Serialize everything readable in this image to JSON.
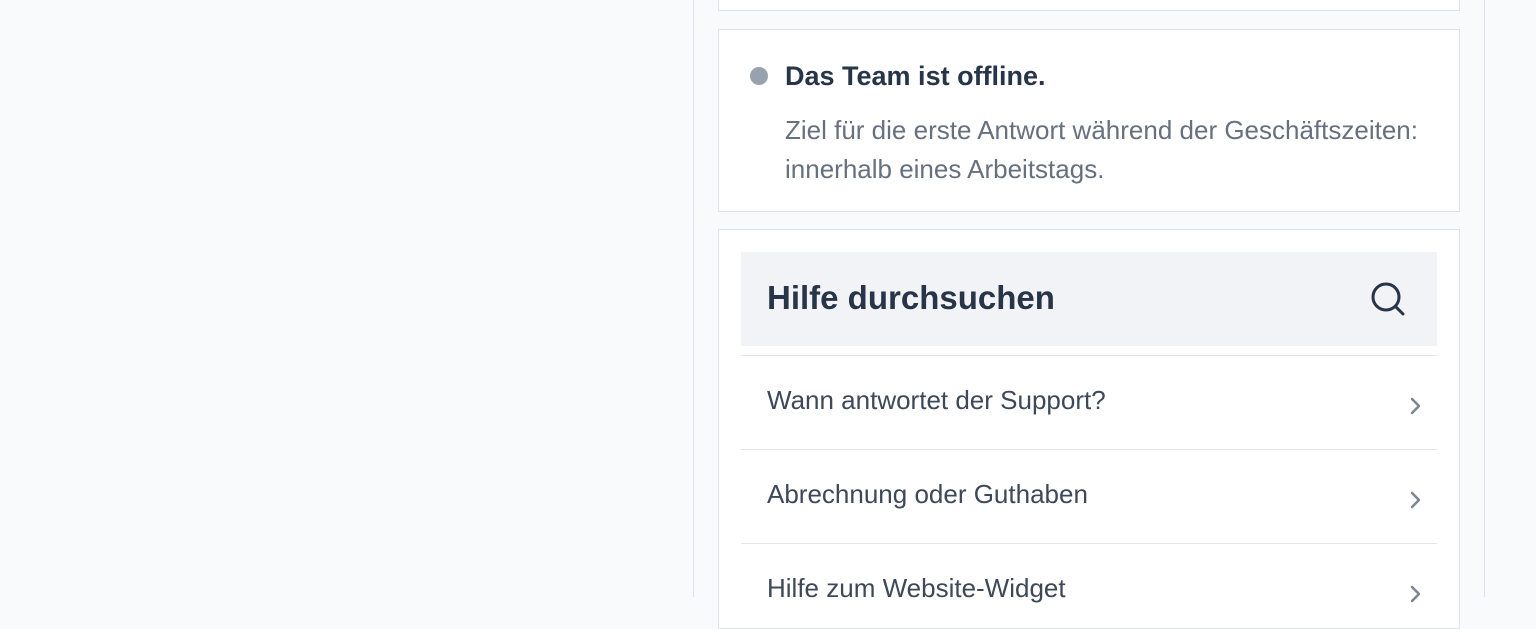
{
  "status": {
    "title": "Das Team ist offline.",
    "description": "Ziel für die erste Antwort während der Geschäftszeiten: innerhalb eines Arbeitstags.",
    "dot_color": "#98a1ae"
  },
  "help": {
    "search_title": "Hilfe durchsuchen",
    "search_icon": "search-icon",
    "items": [
      {
        "label": "Wann antwortet der Support?",
        "icon": "chevron-right-icon"
      },
      {
        "label": "Abrechnung oder Guthaben",
        "icon": "chevron-right-icon"
      },
      {
        "label": "Hilfe zum Website-Widget",
        "icon": "chevron-right-icon"
      }
    ]
  }
}
